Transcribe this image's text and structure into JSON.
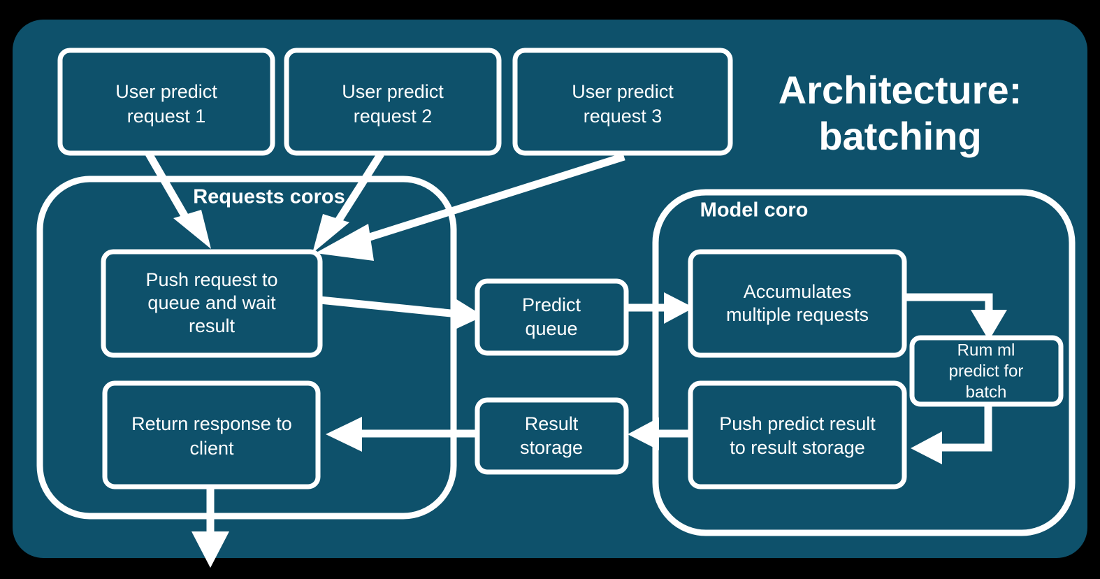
{
  "title": {
    "line1": "Architecture:",
    "line2": "batching"
  },
  "colors": {
    "panel": "#0E516B",
    "stroke": "#FFFFFF",
    "backdrop": "#000000"
  },
  "requests": [
    {
      "line1": "User predict",
      "line2": "request 1"
    },
    {
      "line1": "User predict",
      "line2": "request 2"
    },
    {
      "line1": "User predict",
      "line2": "request 3"
    }
  ],
  "groups": {
    "requests_coros": {
      "label": "Requests coros"
    },
    "model_coro": {
      "label": "Model coro"
    }
  },
  "nodes": {
    "push_request": {
      "line1": "Push request to",
      "line2": "queue and wait",
      "line3": "result"
    },
    "return_response": {
      "line1": "Return response to",
      "line2": "client"
    },
    "predict_queue": {
      "line1": "Predict",
      "line2": "queue"
    },
    "result_storage": {
      "line1": "Result",
      "line2": "storage"
    },
    "accumulates": {
      "line1": "Accumulates",
      "line2": "multiple requests"
    },
    "run_ml_predict": {
      "line1": "Rum ml",
      "line2": "predict for",
      "line3": "batch"
    },
    "push_predict_result": {
      "line1": "Push predict result",
      "line2": "to result storage"
    }
  },
  "flows": [
    {
      "name": "request-1-to-push",
      "from": "User predict request 1",
      "to": "Push request to queue and wait result"
    },
    {
      "name": "request-2-to-push",
      "from": "User predict request 2",
      "to": "Push request to queue and wait result"
    },
    {
      "name": "request-3-to-push",
      "from": "User predict request 3",
      "to": "Push request to queue and wait result"
    },
    {
      "name": "push-to-predict-queue",
      "from": "Push request to queue and wait result",
      "to": "Predict queue"
    },
    {
      "name": "predict-queue-to-accumulates",
      "from": "Predict queue",
      "to": "Accumulates multiple requests"
    },
    {
      "name": "accumulates-to-run-ml",
      "from": "Accumulates multiple requests",
      "to": "Rum ml predict for batch"
    },
    {
      "name": "run-ml-to-push-result",
      "from": "Rum ml predict for batch",
      "to": "Push predict result to result storage"
    },
    {
      "name": "push-result-to-result-storage",
      "from": "Push predict result to result storage",
      "to": "Result storage"
    },
    {
      "name": "result-storage-to-return",
      "from": "Result storage",
      "to": "Return response to client"
    },
    {
      "name": "return-to-client-out",
      "from": "Return response to client",
      "to": "client"
    }
  ]
}
